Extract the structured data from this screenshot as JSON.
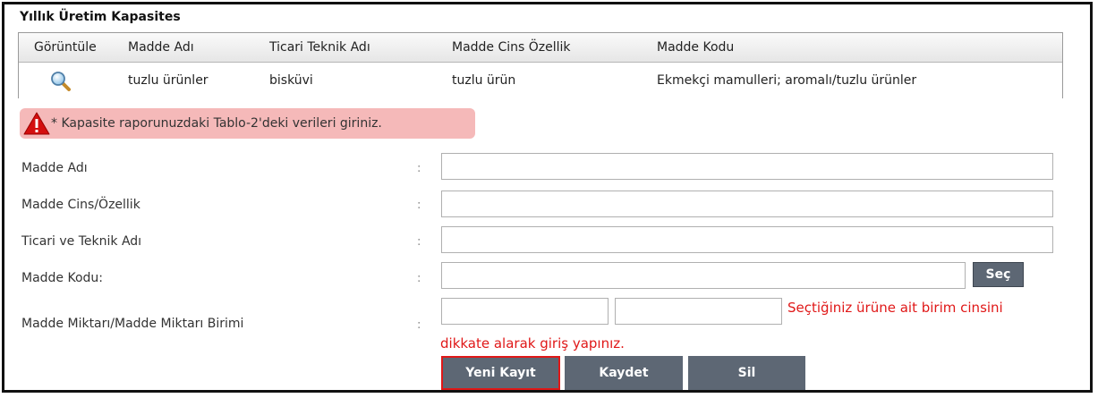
{
  "panel": {
    "title": "Yıllık Üretim Kapasites"
  },
  "grid": {
    "columns": [
      "Görüntüle",
      "Madde Adı",
      "Ticari Teknik Adı",
      "Madde Cins Özellik",
      "Madde Kodu"
    ],
    "rows": [
      {
        "view_icon": "magnifier-icon",
        "madde_adi": "tuzlu ürünler",
        "ticari_teknik_adi": "bisküvi",
        "cins_ozellik": "tuzlu ürün",
        "madde_kodu": "Ekmekçi mamulleri; aromalı/tuzlu ürünler"
      }
    ]
  },
  "warning": {
    "icon": "warning-icon",
    "text": "* Kapasite raporunuzdaki Tablo-2'deki verileri giriniz."
  },
  "form": {
    "colon": ":",
    "madde_adi": {
      "label": "Madde Adı",
      "value": ""
    },
    "cins_ozellik": {
      "label": "Madde Cins/Özellik",
      "value": ""
    },
    "ticari_teknik": {
      "label": "Ticari ve Teknik Adı",
      "value": ""
    },
    "madde_kodu": {
      "label": "Madde Kodu:",
      "value": "",
      "select_label": "Seç"
    },
    "miktar": {
      "label": "Madde Miktarı/Madde Miktarı Birimi",
      "value": "",
      "unit_value": ""
    },
    "hint_line1": "Seçtiğiniz ürüne ait birim cinsini",
    "hint_line2": "dikkate alarak giriş yapınız."
  },
  "actions": {
    "new_label": "Yeni Kayıt",
    "save_label": "Kaydet",
    "delete_label": "Sil"
  },
  "colors": {
    "accent_button": "#5d6774",
    "warning_bg": "#f5b9b9",
    "error_text": "#e01818"
  }
}
